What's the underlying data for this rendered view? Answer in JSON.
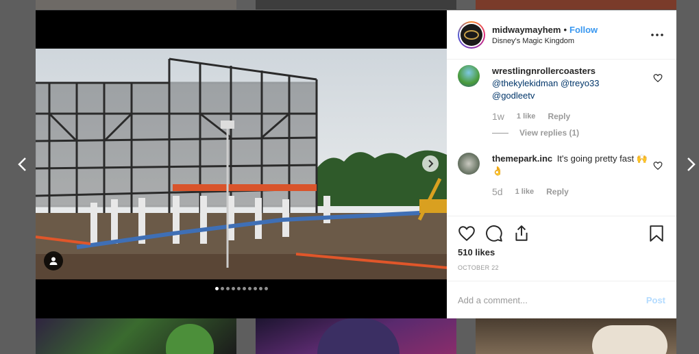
{
  "post": {
    "username": "midwaymayhem",
    "separator": "•",
    "follow_label": "Follow",
    "location": "Disney's Magic Kingdom",
    "more_icon": "more-horizontal-icon",
    "carousel": {
      "slide_count": 10,
      "active_index": 0
    }
  },
  "comments": [
    {
      "username": "wrestlingnrollercoasters",
      "mentions": [
        "@thekylekidman",
        "@treyo33",
        "@godleetv"
      ],
      "time": "1w",
      "likes": "1 like",
      "reply_label": "Reply",
      "view_replies": "View replies (1)"
    },
    {
      "username": "themepark.inc",
      "text": "It's going pretty fast",
      "emoji": "🙌👌",
      "time": "5d",
      "likes": "1 like",
      "reply_label": "Reply"
    }
  ],
  "stats": {
    "likes": "510 likes",
    "date": "OCTOBER 22"
  },
  "composer": {
    "placeholder": "Add a comment...",
    "post_label": "Post"
  },
  "colors": {
    "accent": "#3897f0",
    "mention": "#003569",
    "muted": "#999999",
    "post_disabled": "#b3dbff",
    "overlay": "#5e5e5e"
  }
}
